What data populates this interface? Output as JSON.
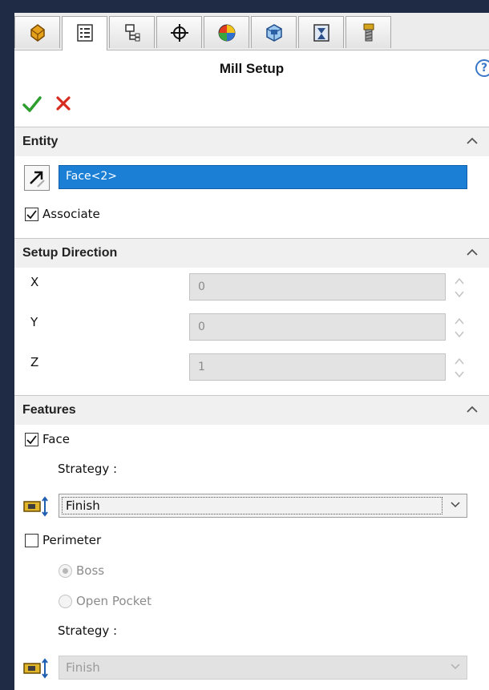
{
  "title": "Mill Setup",
  "help_glyph": "?",
  "toolbar": {
    "tabs": [
      {
        "icon": "feature-manager-icon",
        "active": false
      },
      {
        "icon": "property-manager-icon",
        "active": true
      },
      {
        "icon": "configuration-manager-icon",
        "active": false
      },
      {
        "icon": "crosshair-icon",
        "active": false
      },
      {
        "icon": "appearance-icon",
        "active": false
      },
      {
        "icon": "cam-feature-tree-icon",
        "active": false
      },
      {
        "icon": "cam-operation-tree-icon",
        "active": false
      },
      {
        "icon": "cam-tool-tree-icon",
        "active": false
      }
    ]
  },
  "entity": {
    "header": "Entity",
    "value": "Face<2>",
    "associate_label": "Associate",
    "associate_checked": true
  },
  "setup_direction": {
    "header": "Setup Direction",
    "axes": [
      {
        "label": "X",
        "value": "0"
      },
      {
        "label": "Y",
        "value": "0"
      },
      {
        "label": "Z",
        "value": "1"
      }
    ]
  },
  "features": {
    "header": "Features",
    "face_label": "Face",
    "face_checked": true,
    "strategy_label": "Strategy :",
    "face_strategy": "Finish",
    "perimeter_label": "Perimeter",
    "perimeter_checked": false,
    "boss_label": "Boss",
    "open_pocket_label": "Open Pocket",
    "perimeter_strategy_label": "Strategy :",
    "perimeter_strategy": "Finish"
  },
  "colors": {
    "accent_blue": "#1b7fd6",
    "ok_green": "#2e9e2e",
    "cancel_red": "#d62b1f"
  }
}
